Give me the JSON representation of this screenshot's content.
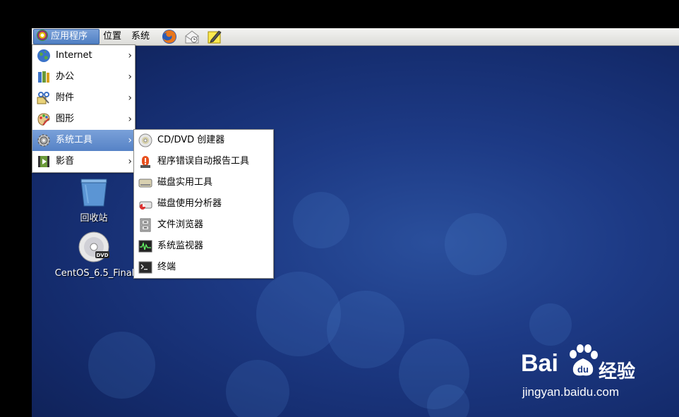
{
  "panel": {
    "applications": "应用程序",
    "places": "位置",
    "system": "系统"
  },
  "apps_menu": {
    "items": [
      {
        "label": "Internet",
        "icon": "globe-icon"
      },
      {
        "label": "办公",
        "icon": "office-icon"
      },
      {
        "label": "附件",
        "icon": "accessories-icon"
      },
      {
        "label": "图形",
        "icon": "graphics-icon"
      },
      {
        "label": "系统工具",
        "icon": "system-tools-icon"
      },
      {
        "label": "影音",
        "icon": "multimedia-icon"
      }
    ]
  },
  "submenu": {
    "items": [
      {
        "label": "CD/DVD 创建器",
        "icon": "cd-icon"
      },
      {
        "label": "程序错误自动报告工具",
        "icon": "alert-icon"
      },
      {
        "label": "磁盘实用工具",
        "icon": "disk-icon"
      },
      {
        "label": "磁盘使用分析器",
        "icon": "disk-usage-icon"
      },
      {
        "label": "文件浏览器",
        "icon": "file-cabinet-icon"
      },
      {
        "label": "系统监视器",
        "icon": "monitor-icon"
      },
      {
        "label": "终端",
        "icon": "terminal-icon"
      }
    ]
  },
  "desktop": {
    "trash": "回收站",
    "dvd": "CentOS_6.5_Final",
    "dvd_badge": "DVD"
  },
  "watermark": {
    "brand_left": "Bai",
    "brand_right": "经验",
    "url": "jingyan.baidu.com"
  }
}
